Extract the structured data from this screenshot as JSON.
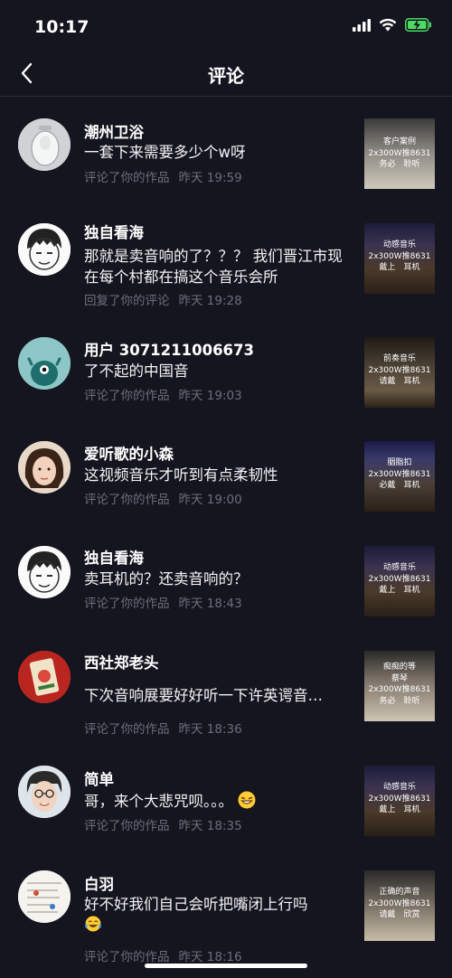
{
  "status": {
    "time": "10:17"
  },
  "nav": {
    "title": "评论"
  },
  "comments": [
    {
      "name": "潮州卫浴",
      "text": "一套下来需要多少个w呀",
      "action": "评论了你的作品",
      "time": "昨天 19:59",
      "thumb": {
        "l1": "客户案例",
        "l2": "2x300W推8631",
        "l3": "务必　聆听"
      }
    },
    {
      "name": "独自看海",
      "text": "那就是卖音响的了？？？ 我们晋江市现在每个村都在搞这个音乐会所",
      "action": "回复了你的评论",
      "time": "昨天 19:28",
      "thumb": {
        "l1": "动感音乐",
        "l2": "2x300W推8631",
        "l3": "戴上　耳机"
      }
    },
    {
      "name": "用户 3071211006673",
      "text": "了不起的中国音",
      "action": "评论了你的作品",
      "time": "昨天 19:03",
      "thumb": {
        "l1": "前奏音乐",
        "l2": "2x300W推8631",
        "l3": "请戴　耳机"
      }
    },
    {
      "name": "爱听歌的小森",
      "text": "这视频音乐才听到有点柔韧性",
      "action": "评论了你的作品",
      "time": "昨天 19:00",
      "thumb": {
        "l1": "胭脂扣",
        "l2": "2x300W推8631",
        "l3": "必戴　耳机"
      }
    },
    {
      "name": "独自看海",
      "text": "卖耳机的？还卖音响的？",
      "action": "评论了你的作品",
      "time": "昨天 18:43",
      "thumb": {
        "l1": "动感音乐",
        "l2": "2x300W推8631",
        "l3": "戴上　耳机"
      }
    },
    {
      "name": "西社郑老头",
      "text": "下次音响展要好好听一下许英谔音…",
      "action": "评论了你的作品",
      "time": "昨天 18:36",
      "thumb": {
        "l1": "痴痴的等",
        "l2": "蔡琴",
        "l3": "2x300W推8631",
        "l4": "务必　聆听"
      }
    },
    {
      "name": "简单",
      "text": "哥，来个大悲咒呗。。。",
      "action": "评论了你的作品",
      "time": "昨天 18:35",
      "thumb": {
        "l1": "动感音乐",
        "l2": "2x300W推8631",
        "l3": "戴上　耳机"
      }
    },
    {
      "name": "白羽",
      "text": "好不好我们自己会听把嘴闭上行吗",
      "action": "评论了你的作品",
      "time": "昨天 18:16",
      "thumb": {
        "l1": "正确的声音",
        "l2": "2x300W推8631",
        "l3": "请戴　欣赏"
      }
    }
  ],
  "icons": {
    "back": "chevron-left-icon",
    "signal": "signal-icon",
    "wifi": "wifi-icon",
    "battery": "battery-charging-icon"
  },
  "colors": {
    "background": "#15151f",
    "meta": "#6e6e7c",
    "battery": "#4cd964"
  }
}
